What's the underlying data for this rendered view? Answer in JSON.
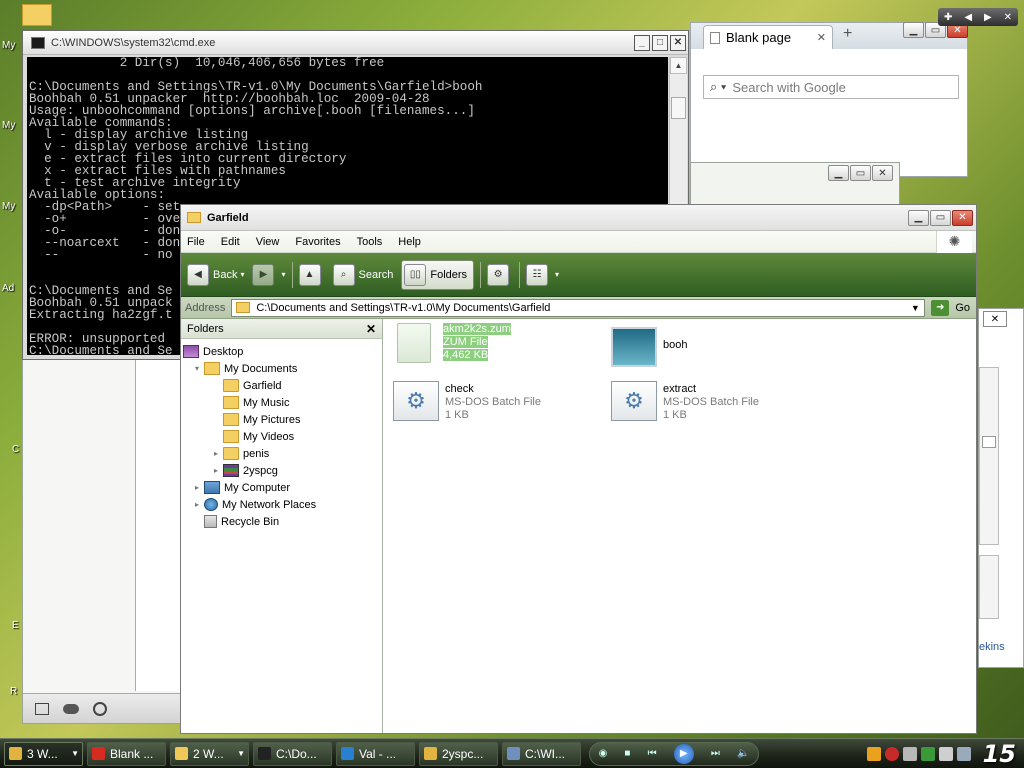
{
  "desktop_icon_labels": [
    "My",
    "My",
    "My",
    "Ad",
    "C",
    "E",
    "R"
  ],
  "cmd": {
    "title": "C:\\WINDOWS\\system32\\cmd.exe",
    "lines": [
      "            2 Dir(s)  10,046,406,656 bytes free",
      "",
      "C:\\Documents and Settings\\TR-v1.0\\My Documents\\Garfield>booh",
      "Boohbah 0.51 unpacker  http://boohbah.loc  2009-04-28",
      "Usage: unboohcommand [options] archive[.booh [filenames...]",
      "Available commands:",
      "  l - display archive listing",
      "  v - display verbose archive listing",
      "  e - extract files into current directory",
      "  x - extract files with pathnames",
      "  t - test archive integrity",
      "Available options:",
      "  -dp<Path>    - set",
      "  -o+          - ove",
      "  -o-          - don",
      "  --noarcext   - don",
      "  --           - no",
      "",
      "",
      "C:\\Documents and Se",
      "Boohbah 0.51 unpack",
      "Extracting ha2zgf.t",
      "",
      "ERROR: unsupported",
      "C:\\Documents and Se"
    ]
  },
  "browser": {
    "tab_title": "Blank page",
    "search_placeholder": "Search with Google"
  },
  "explorer": {
    "title": "Garfield",
    "menu": [
      "File",
      "Edit",
      "View",
      "Favorites",
      "Tools",
      "Help"
    ],
    "toolbar": {
      "back": "Back",
      "search": "Search",
      "folders": "Folders"
    },
    "address_label": "Address",
    "address_value": "C:\\Documents and Settings\\TR-v1.0\\My Documents\\Garfield",
    "go_label": "Go",
    "folders_pane_title": "Folders",
    "tree": [
      {
        "label": "Desktop",
        "level": 0,
        "exp": ""
      },
      {
        "label": "My Documents",
        "level": 1,
        "exp": "◢"
      },
      {
        "label": "Garfield",
        "level": 2,
        "exp": ""
      },
      {
        "label": "My Music",
        "level": 2,
        "exp": ""
      },
      {
        "label": "My Pictures",
        "level": 2,
        "exp": ""
      },
      {
        "label": "My Videos",
        "level": 2,
        "exp": ""
      },
      {
        "label": "penis",
        "level": 2,
        "exp": "▷"
      },
      {
        "label": "2yspcg",
        "level": 2,
        "exp": "▷"
      },
      {
        "label": "My Computer",
        "level": 1,
        "exp": "▷"
      },
      {
        "label": "My Network Places",
        "level": 1,
        "exp": "▷"
      },
      {
        "label": "Recycle Bin",
        "level": 1,
        "exp": ""
      }
    ],
    "files": [
      {
        "name": "akm2k2s.zum",
        "type": "ZUM File",
        "size": "4,462 KB",
        "selected": true
      },
      {
        "name": "booh",
        "type": "",
        "size": "",
        "selected": false
      },
      {
        "name": "check",
        "type": "MS-DOS Batch File",
        "size": "1 KB",
        "selected": false
      },
      {
        "name": "extract",
        "type": "MS-DOS Batch File",
        "size": "1 KB",
        "selected": false
      }
    ]
  },
  "side_window_text": "ekins",
  "taskbar": {
    "tasks": [
      {
        "label": "3 W...",
        "caret": true,
        "color": "#e3b341",
        "active": true
      },
      {
        "label": "Blank ...",
        "caret": false,
        "color": "#d62b1f",
        "active": false
      },
      {
        "label": "2 W...",
        "caret": true,
        "color": "#f0c85a",
        "active": false
      },
      {
        "label": "C:\\Do...",
        "caret": false,
        "color": "#222222",
        "active": false
      },
      {
        "label": "Val - ...",
        "caret": false,
        "color": "#2a80d0",
        "active": false
      },
      {
        "label": "2yspc...",
        "caret": false,
        "color": "#e3b341",
        "active": false
      },
      {
        "label": "C:\\WI...",
        "caret": false,
        "color": "#6f8fbf",
        "active": false
      }
    ],
    "clock": "15"
  }
}
